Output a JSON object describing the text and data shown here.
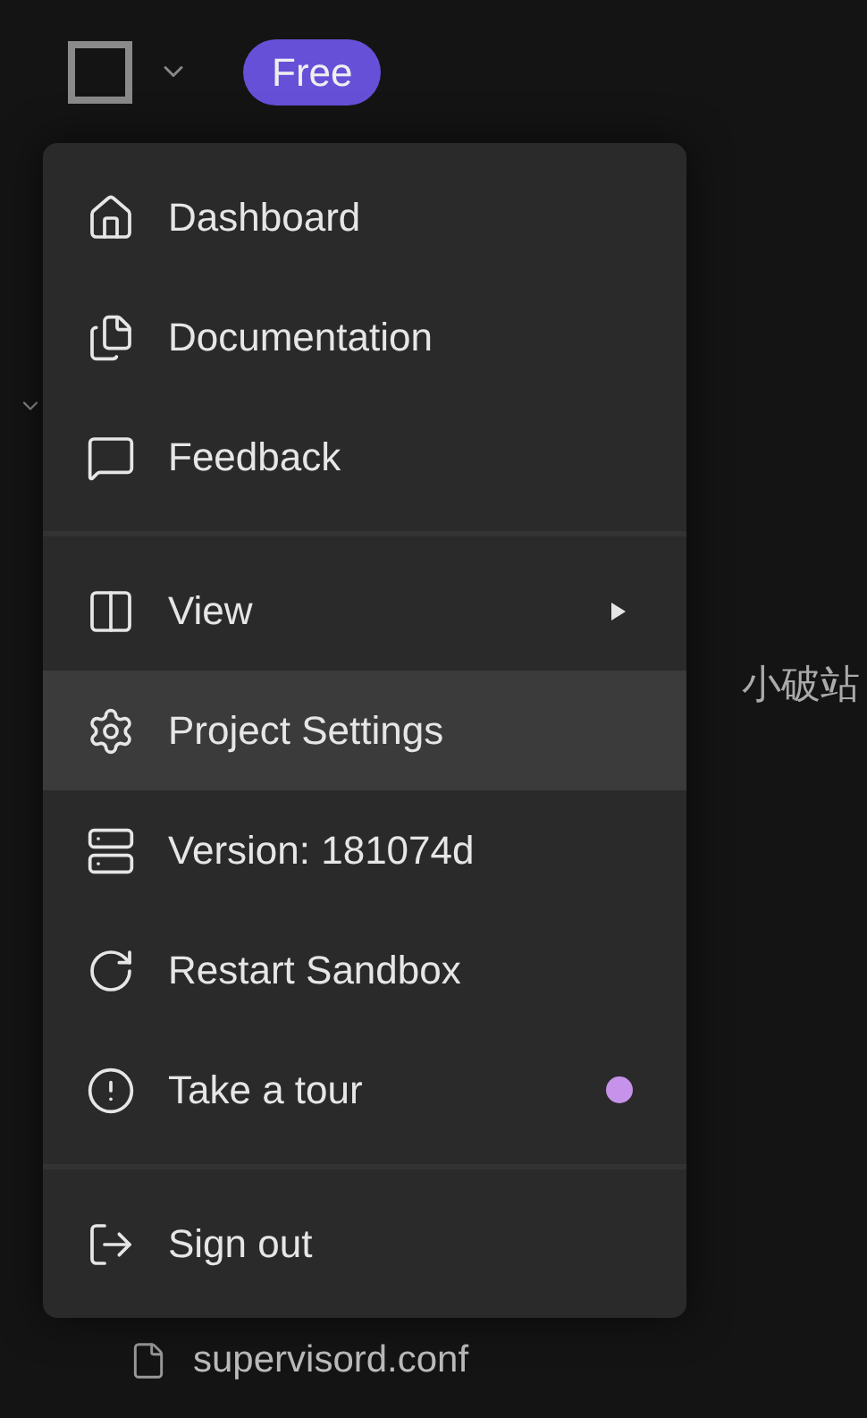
{
  "header": {
    "badge": "Free"
  },
  "background": {
    "side_text": "小破站",
    "file": "supervisord.conf"
  },
  "menu": {
    "sections": [
      [
        {
          "label": "Dashboard",
          "kind": "plain",
          "selected": false
        },
        {
          "label": "Documentation",
          "kind": "plain",
          "selected": false
        },
        {
          "label": "Feedback",
          "kind": "plain",
          "selected": false
        }
      ],
      [
        {
          "label": "View",
          "kind": "submenu",
          "selected": false
        },
        {
          "label": "Project Settings",
          "kind": "plain",
          "selected": true
        },
        {
          "label": "Version: 181074d",
          "kind": "plain",
          "selected": false
        },
        {
          "label": "Restart Sandbox",
          "kind": "plain",
          "selected": false
        },
        {
          "label": "Take a tour",
          "kind": "dot",
          "color": "#c792ea",
          "selected": false
        }
      ],
      [
        {
          "label": "Sign out",
          "kind": "plain",
          "selected": false
        }
      ]
    ]
  }
}
